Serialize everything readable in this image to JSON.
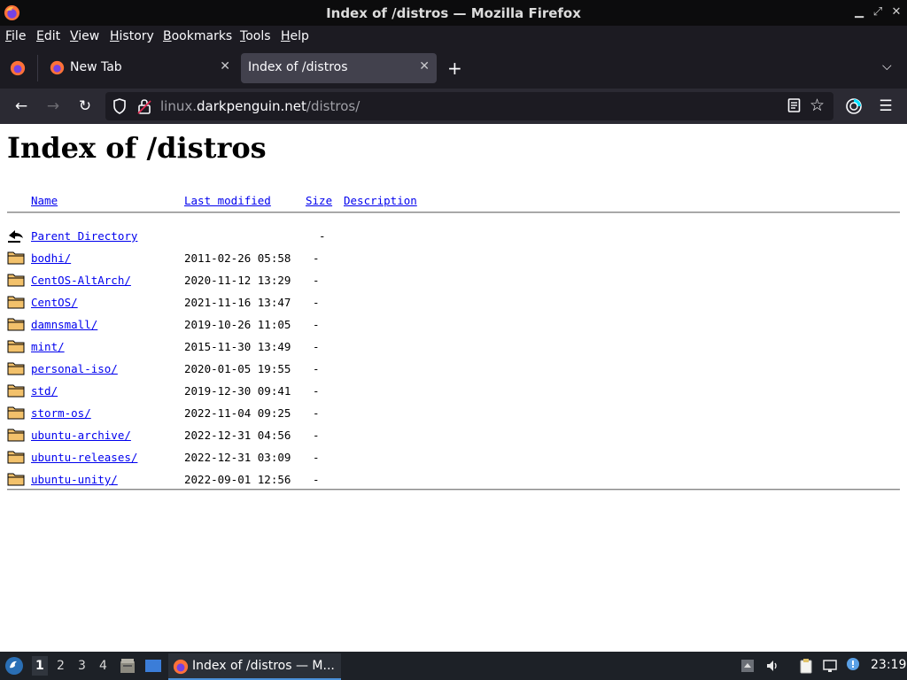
{
  "window": {
    "title": "Index of /distros — Mozilla Firefox",
    "controls": [
      "minimize-icon",
      "restore-icon",
      "close-icon"
    ]
  },
  "menubar": {
    "items": [
      {
        "label": "File",
        "accel": "F"
      },
      {
        "label": "Edit",
        "accel": "E"
      },
      {
        "label": "View",
        "accel": "V"
      },
      {
        "label": "History",
        "accel": "H"
      },
      {
        "label": "Bookmarks",
        "accel": "B"
      },
      {
        "label": "Tools",
        "accel": "T"
      },
      {
        "label": "Help",
        "accel": "H"
      }
    ]
  },
  "tabs": [
    {
      "label": "New Tab",
      "active": false,
      "close": "✕"
    },
    {
      "label": "Index of /distros",
      "active": true,
      "close": "✕"
    }
  ],
  "navbar": {
    "url_prefix": "linux.",
    "url_host": "darkpenguin.net",
    "url_path": "/distros/"
  },
  "page": {
    "heading": "Index of /distros",
    "columns": {
      "name": "Name",
      "modified": "Last modified",
      "size": "Size",
      "description": "Description"
    },
    "parent": {
      "name": "Parent Directory",
      "size": "-"
    },
    "entries": [
      {
        "name": "bodhi/",
        "modified": "2011-02-26 05:58",
        "size": "-"
      },
      {
        "name": "CentOS-AltArch/",
        "modified": "2020-11-12 13:29",
        "size": "-"
      },
      {
        "name": "CentOS/",
        "modified": "2021-11-16 13:47",
        "size": "-"
      },
      {
        "name": "damnsmall/",
        "modified": "2019-10-26 11:05",
        "size": "-"
      },
      {
        "name": "mint/",
        "modified": "2015-11-30 13:49",
        "size": "-"
      },
      {
        "name": "personal-iso/",
        "modified": "2020-01-05 19:55",
        "size": "-"
      },
      {
        "name": "std/",
        "modified": "2019-12-30 09:41",
        "size": "-"
      },
      {
        "name": "storm-os/",
        "modified": "2022-11-04 09:25",
        "size": "-"
      },
      {
        "name": "ubuntu-archive/",
        "modified": "2022-12-31 04:56",
        "size": "-"
      },
      {
        "name": "ubuntu-releases/",
        "modified": "2022-12-31 03:09",
        "size": "-"
      },
      {
        "name": "ubuntu-unity/",
        "modified": "2022-09-01 12:56",
        "size": "-"
      }
    ]
  },
  "taskbar": {
    "workspaces": [
      "1",
      "2",
      "3",
      "4"
    ],
    "active_workspace": "1",
    "task_label": "Index of /distros — M...",
    "clock": "23:19"
  },
  "colors": {
    "link": "#0000ee",
    "firefox_orange": "#ff7139",
    "taskbar_accent": "#4a90d9"
  }
}
